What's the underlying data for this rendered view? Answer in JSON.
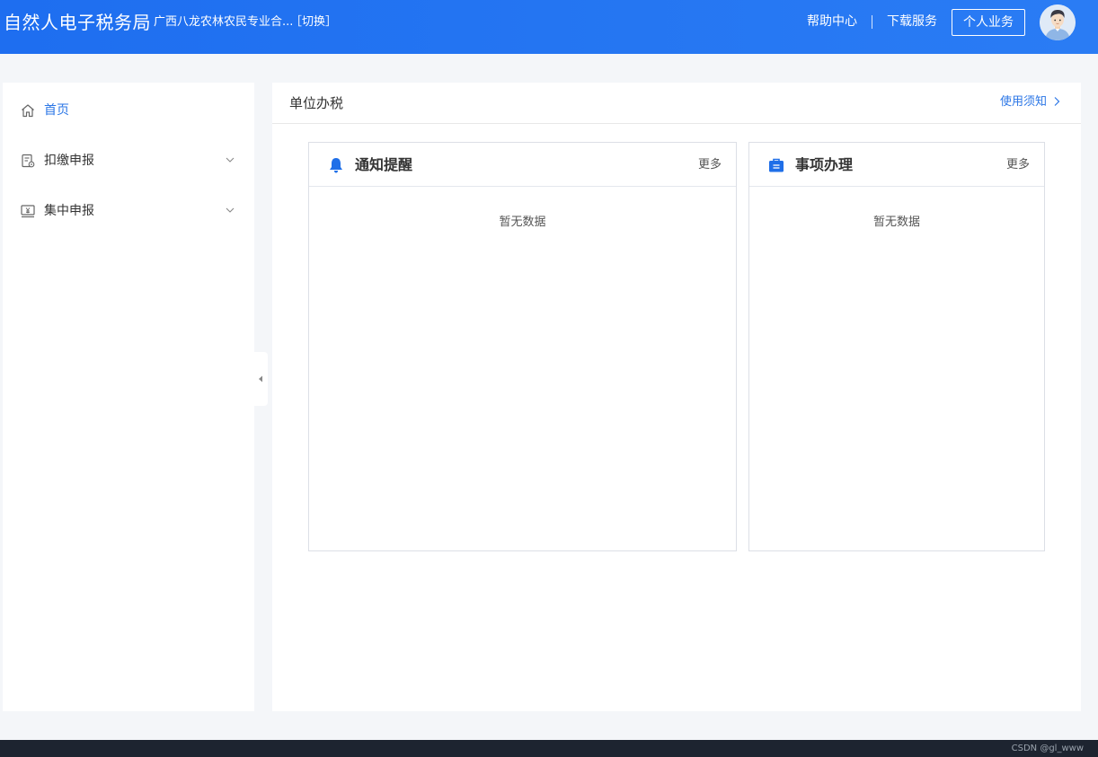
{
  "header": {
    "brand": "自然人电子税务局",
    "org": "广西八龙农林农民专业合...",
    "switch_label": "［切换］",
    "help_label": "帮助中心",
    "download_label": "下载服务",
    "personal_label": "个人业务",
    "avatar_icon": "user-avatar-icon"
  },
  "sidebar": {
    "items": [
      {
        "label": "首页",
        "icon": "home-icon",
        "active": true
      },
      {
        "label": "扣缴申报",
        "icon": "document-icon",
        "expandable": true
      },
      {
        "label": "集中申报",
        "icon": "monitor-yuan-icon",
        "expandable": true
      }
    ]
  },
  "main": {
    "title": "单位办税",
    "notice_label": "使用须知",
    "cards": [
      {
        "title": "通知提醒",
        "icon": "bell-icon",
        "more": "更多",
        "empty": "暂无数据"
      },
      {
        "title": "事项办理",
        "icon": "briefcase-icon",
        "more": "更多",
        "empty": "暂无数据"
      }
    ]
  },
  "colors": {
    "header_bg": "#1e6ef0",
    "accent": "#2b76e6",
    "page_bg": "#f4f6f9",
    "footer_bg": "#1d2430"
  },
  "footer": {
    "watermark": "CSDN @gl_www"
  }
}
